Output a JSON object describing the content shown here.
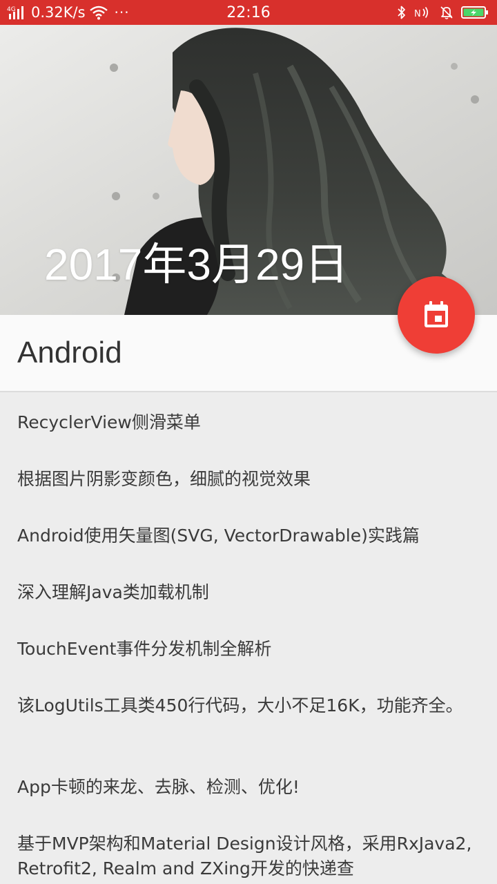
{
  "status_bar": {
    "network_type": "4G",
    "speed": "0.32K/s",
    "more": "···",
    "time": "22:16",
    "icons": [
      "signal-icon",
      "wifi-icon",
      "bluetooth-icon",
      "nfc-icon",
      "bell-muted-icon",
      "battery-charging-icon"
    ],
    "bg_color": "#d8302c"
  },
  "header": {
    "date": "2017年3月29日"
  },
  "toolbar": {
    "title": "Android"
  },
  "fab": {
    "icon": "calendar-icon",
    "color": "#ef3e36"
  },
  "articles": [
    {
      "title": "RecyclerView侧滑菜单"
    },
    {
      "title": "根据图片阴影变颜色，细腻的视觉效果"
    },
    {
      "title": "Android使用矢量图(SVG, VectorDrawable)实践篇"
    },
    {
      "title": "深入理解Java类加载机制"
    },
    {
      "title": "TouchEvent事件分发机制全解析"
    },
    {
      "title": "该LogUtils工具类450行代码，大小不足16K，功能齐全。"
    },
    {
      "title": "App卡顿的来龙、去脉、检测、优化!"
    },
    {
      "title": "基于MVP架构和Material Design设计风格，采用RxJava2, Retrofit2, Realm and ZXing开发的快递查"
    }
  ]
}
